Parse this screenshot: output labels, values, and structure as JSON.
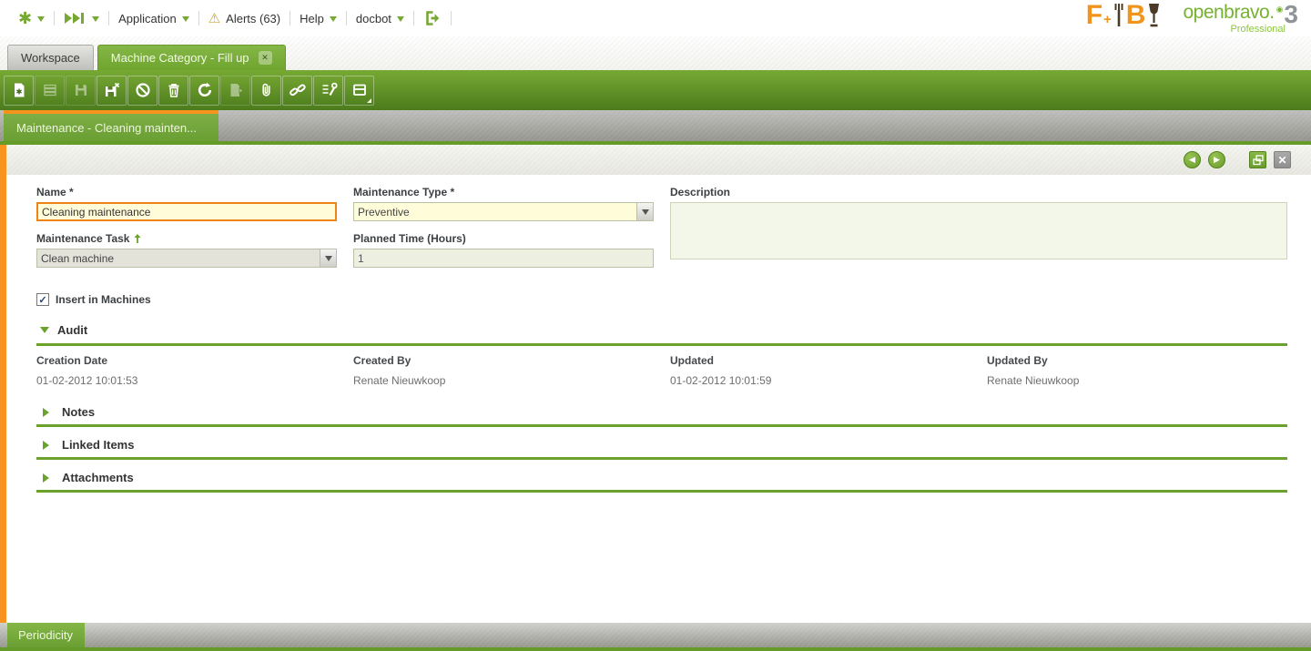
{
  "menubar": {
    "application": "Application",
    "alerts": "Alerts (63)",
    "help": "Help",
    "user": "docbot"
  },
  "logo": {
    "brand_f": "F",
    "brand_plus": "+",
    "brand_b": "B",
    "product": "openbravo.",
    "product_sup": "3",
    "edition": "Professional"
  },
  "tabs": {
    "workspace": "Workspace",
    "active": "Machine Category - Fill up"
  },
  "toolbar": {
    "icons": [
      "new-record",
      "grid-save",
      "save",
      "save-close",
      "undo",
      "delete",
      "refresh",
      "export",
      "attachment",
      "link",
      "tools",
      "grid-form-toggle"
    ],
    "disabled": [
      "grid-save",
      "save",
      "export"
    ]
  },
  "breadcrumb": {
    "label": "Maintenance - Cleaning mainten..."
  },
  "icons": {
    "check": "✓",
    "tab_close": "✕",
    "prev": "◀",
    "next": "▶",
    "close_x": "✕"
  },
  "form": {
    "name": {
      "label": "Name *",
      "value": "Cleaning maintenance"
    },
    "maintenance_type": {
      "label": "Maintenance Type *",
      "value": "Preventive"
    },
    "description": {
      "label": "Description",
      "value": ""
    },
    "maintenance_task": {
      "label": "Maintenance Task",
      "value": "Clean machine"
    },
    "planned_time": {
      "label": "Planned Time (Hours)",
      "value": "1"
    },
    "insert_in_machines": {
      "label": "Insert in Machines",
      "checked": true
    }
  },
  "sections": {
    "audit": "Audit",
    "notes": "Notes",
    "linked_items": "Linked Items",
    "attachments": "Attachments"
  },
  "audit": {
    "creation_date": {
      "label": "Creation Date",
      "value": "01-02-2012 10:01:53"
    },
    "created_by": {
      "label": "Created By",
      "value": "Renate Nieuwkoop"
    },
    "updated": {
      "label": "Updated",
      "value": "01-02-2012 10:01:59"
    },
    "updated_by": {
      "label": "Updated By",
      "value": "Renate Nieuwkoop"
    }
  },
  "bottom": {
    "tab": "Periodicity"
  },
  "colors": {
    "green": "#76a833",
    "orange": "#f7941d",
    "field_yellow": "#fffcd9",
    "focus_border": "#ee8418",
    "section_line": "#6aa32b"
  }
}
